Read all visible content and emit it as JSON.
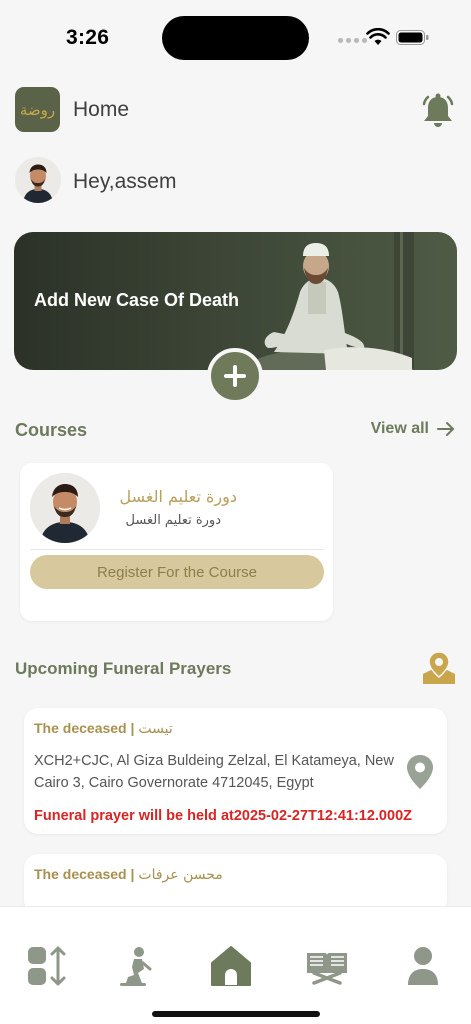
{
  "status_bar": {
    "time": "3:26"
  },
  "header": {
    "logo_text": "روضة",
    "title": "Home"
  },
  "greeting": {
    "text": "Hey,assem"
  },
  "hero": {
    "title": "Add New Case Of Death"
  },
  "courses": {
    "section_title": "Courses",
    "view_all_label": "View all",
    "items": [
      {
        "title": "دورة تعليم الغسل",
        "subtitle": "دورة تعليم الغسل",
        "register_label": "Register For the Course"
      }
    ]
  },
  "funerals": {
    "section_title": "Upcoming Funeral Prayers",
    "items": [
      {
        "deceased_label": "The deceased |",
        "deceased_name": "تيست",
        "address": "XCH2+CJC, Al Giza Buldeing Zelzal, El Katameya, New Cairo 3, Cairo Governorate 4712045, Egypt",
        "prayer_time": "Funeral prayer will be held at2025-02-27T12:41:12.000Z"
      },
      {
        "deceased_label": "The deceased |",
        "deceased_name": "محسن عرفات"
      }
    ]
  },
  "tab_bar": {
    "items": [
      {
        "icon": "sort-icon",
        "active": false
      },
      {
        "icon": "prayer-icon",
        "active": false
      },
      {
        "icon": "home-icon",
        "active": true
      },
      {
        "icon": "quran-icon",
        "active": false
      },
      {
        "icon": "profile-icon",
        "active": false
      }
    ]
  },
  "colors": {
    "primary_green": "#6d7a5c",
    "gold": "#b9a05c",
    "alert_red": "#d92424",
    "background": "#f6f6f6"
  }
}
